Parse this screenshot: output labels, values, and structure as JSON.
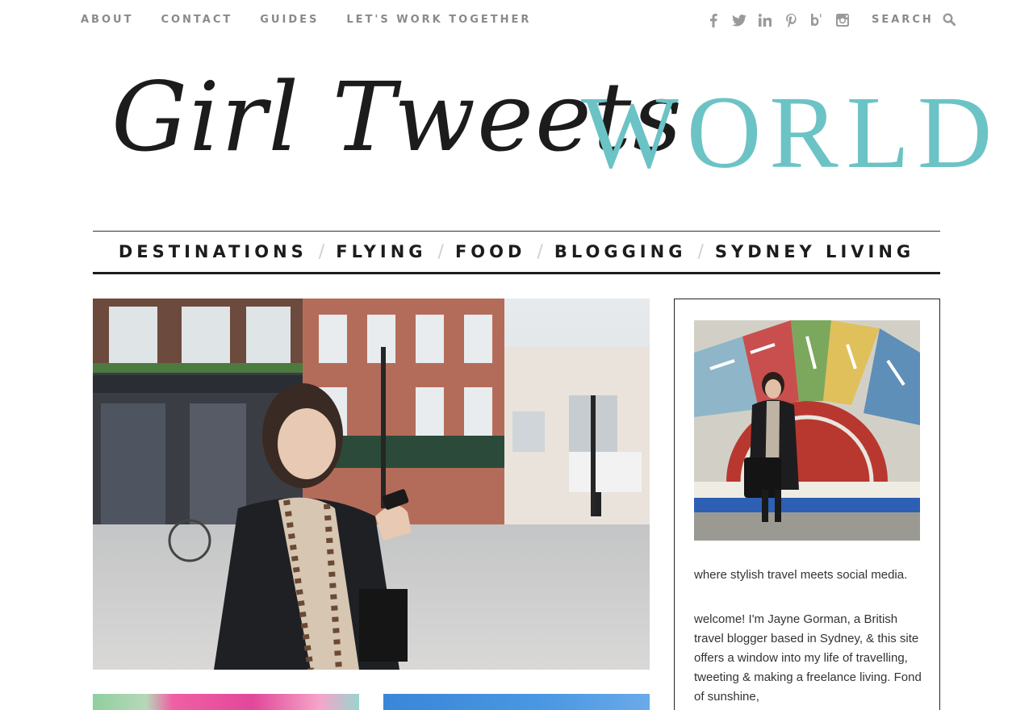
{
  "top_nav": {
    "items": [
      {
        "label": "ABOUT"
      },
      {
        "label": "CONTACT"
      },
      {
        "label": "GUIDES"
      },
      {
        "label": "LET'S WORK TOGETHER"
      }
    ]
  },
  "social": {
    "icons": [
      "facebook-icon",
      "twitter-icon",
      "linkedin-icon",
      "pinterest-icon",
      "bloglovin-icon",
      "instagram-icon"
    ]
  },
  "search": {
    "placeholder": "SEARCH"
  },
  "logo": {
    "script_text": "Girl Tweets",
    "world_text": "WORLD",
    "accent_color": "#6cc3c5"
  },
  "category_nav": {
    "items": [
      {
        "label": "DESTINATIONS"
      },
      {
        "label": "FLYING"
      },
      {
        "label": "FOOD"
      },
      {
        "label": "BLOGGING"
      },
      {
        "label": "SYDNEY LIVING"
      }
    ],
    "separator": "/"
  },
  "sidebar": {
    "tagline": "where stylish travel meets social media.",
    "bio": "welcome! I'm Jayne Gorman, a British travel blogger based in Sydney, & this site offers a window into my life of travelling, tweeting & making a freelance living. Fond of sunshine,"
  }
}
